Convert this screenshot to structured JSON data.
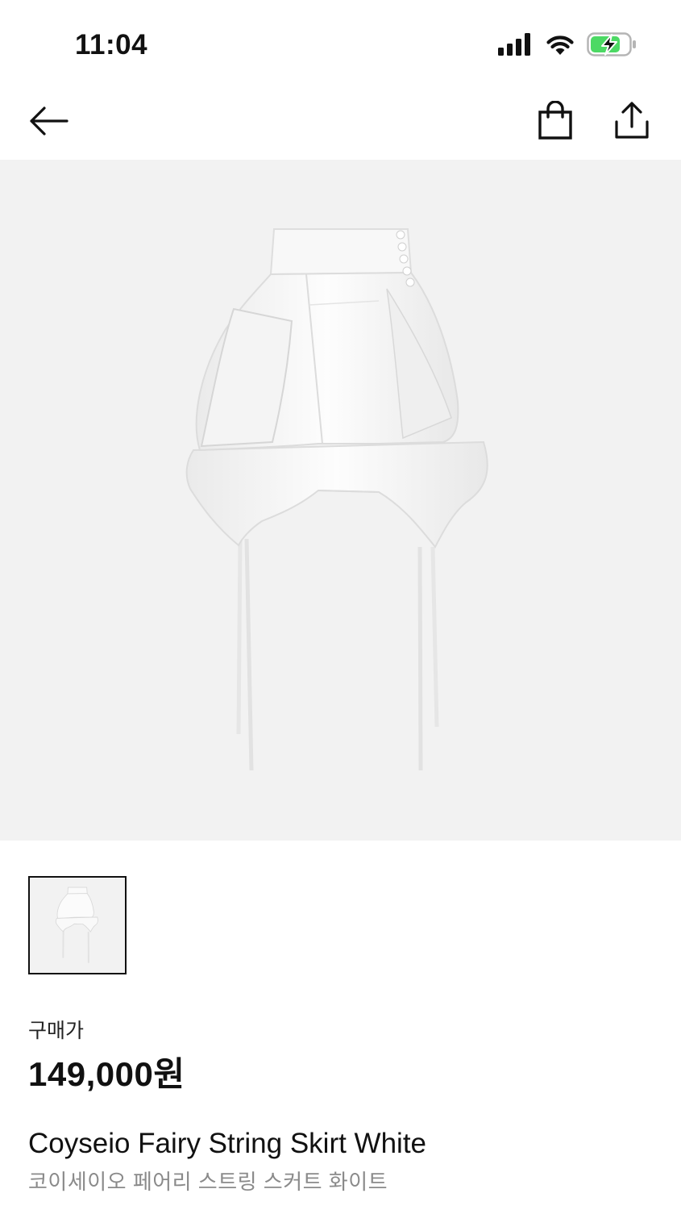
{
  "status": {
    "time": "11:04",
    "battery_color": "#4cd964"
  },
  "nav": {
    "back_icon": "arrow-left-icon",
    "cart_icon": "shopping-bag-icon",
    "share_icon": "share-upload-icon"
  },
  "product": {
    "price_label": "구매가",
    "price": "149,000원",
    "name": "Coyseio Fairy String Skirt White",
    "name_ko": "코이세이오 페어리 스트링 스커트 화이트"
  },
  "colors": {
    "image_background": "#f2f2f2",
    "secondary_text": "#8a8a8a"
  }
}
